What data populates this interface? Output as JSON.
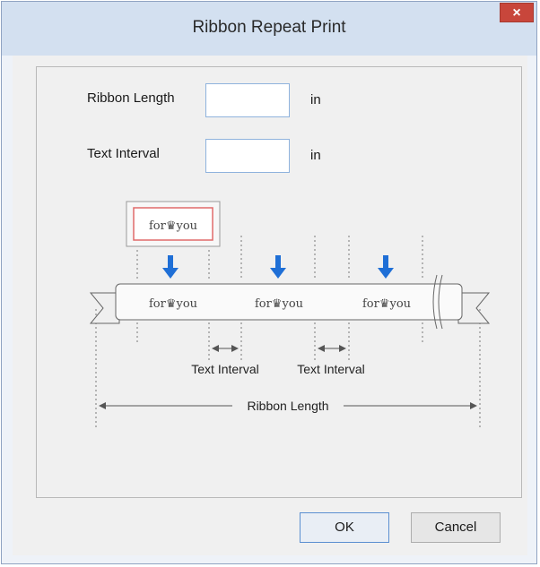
{
  "dialog": {
    "title": "Ribbon Repeat Print",
    "close_glyph": "×"
  },
  "form": {
    "ribbon_length_label": "Ribbon Length",
    "ribbon_length_value": "",
    "ribbon_length_unit": "in",
    "text_interval_label": "Text Interval",
    "text_interval_value": "",
    "text_interval_unit": "in"
  },
  "diagram": {
    "sample_text": "for♛you",
    "interval_label": "Text Interval",
    "length_label": "Ribbon Length"
  },
  "buttons": {
    "ok": "OK",
    "cancel": "Cancel"
  },
  "colors": {
    "arrow": "#1f6fd6",
    "sample_border": "#e06a6a"
  }
}
